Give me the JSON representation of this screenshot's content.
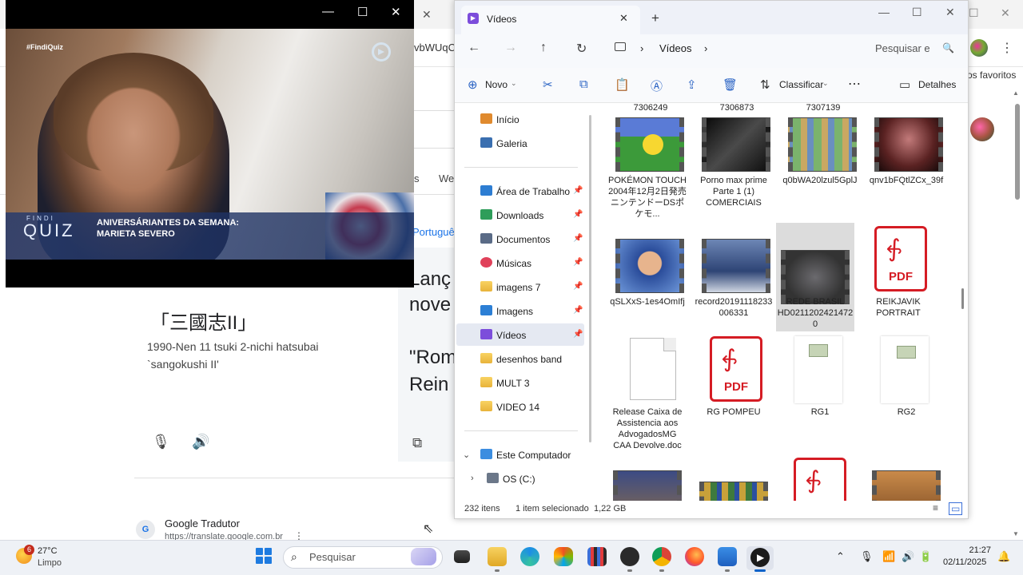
{
  "background_browser": {
    "url_fragment": "vbWUqC",
    "favorites_fragment": "os favoritos",
    "tab_fragments": [
      "s",
      "We"
    ],
    "language_fragment": "Portuguê",
    "kanji": "「三國志II」",
    "romaji_line1": "1990-Nen 11 tsuki 2-nichi hatsubai",
    "romaji_line2": "`sangokushi II'",
    "right_text": [
      "Lanç",
      "nove",
      "\"Rom",
      "Rein"
    ],
    "result_title": "Google Tradutor",
    "result_url": "https://translate.google.com.br",
    "result_icon_text": "G"
  },
  "player": {
    "tag": "#FindiQuiz",
    "findi": "FINDI",
    "quiz": "QUIZ",
    "lower_third_line1": "ANIVERSÁRIANTES DA SEMANA:",
    "lower_third_line2": "MARIETA SEVERO",
    "colors": {
      "lower_third": "#283c6e"
    }
  },
  "explorer": {
    "tab_title": "Vídeos",
    "breadcrumb": [
      "Vídeos"
    ],
    "search_placeholder": "Pesquisar e",
    "toolbar": {
      "new_label": "Novo",
      "sort_label": "Classificar",
      "details_label": "Detalhes"
    },
    "sidebar": [
      {
        "label": "Início",
        "icon": "home-icon",
        "pinned": false
      },
      {
        "label": "Galeria",
        "icon": "gallery-icon",
        "pinned": false
      },
      {
        "label": "Área de Trabalho",
        "icon": "desktop-icon",
        "pinned": true
      },
      {
        "label": "Downloads",
        "icon": "download-icon",
        "pinned": true
      },
      {
        "label": "Documentos",
        "icon": "documents-icon",
        "pinned": true
      },
      {
        "label": "Músicas",
        "icon": "music-icon",
        "pinned": true
      },
      {
        "label": "imagens 7",
        "icon": "folder-icon",
        "pinned": true
      },
      {
        "label": "Imagens",
        "icon": "pictures-icon",
        "pinned": true
      },
      {
        "label": "Vídeos",
        "icon": "videos-icon",
        "pinned": true,
        "selected": true
      },
      {
        "label": "desenhos band",
        "icon": "folder-icon",
        "pinned": false
      },
      {
        "label": "MULT 3",
        "icon": "folder-icon",
        "pinned": false
      },
      {
        "label": "VIDEO 14",
        "icon": "folder-icon",
        "pinned": false
      },
      {
        "label": "Este Computador",
        "icon": "computer-icon",
        "pinned": false
      },
      {
        "label": "OS (C:)",
        "icon": "drive-icon",
        "pinned": false
      }
    ],
    "top_cut_labels": [
      "7306249",
      "7306873",
      "7307139"
    ],
    "files": [
      {
        "name": "POKÉMON TOUCH 2004年12月2日発売 ニンテンドーDSポケモ...",
        "type": "video"
      },
      {
        "name": "Porno max prime Parte 1 (1) COMERCIAIS",
        "type": "video"
      },
      {
        "name": "q0bWA20lzul5GplJ",
        "type": "video"
      },
      {
        "name": "qnv1bFQtlZCx_39f",
        "type": "video"
      },
      {
        "name": "qSLXxS-1es4OmIfj",
        "type": "video"
      },
      {
        "name": "record20191118233006331",
        "type": "video"
      },
      {
        "name": "REDE BRASIL HD02112024214720",
        "type": "video",
        "selected": true
      },
      {
        "name": "REIKJAVIK PORTRAIT",
        "type": "pdf"
      },
      {
        "name": "Release Caixa de Assistencia aos AdvogadosMG CAA Devolve.doc",
        "type": "doc"
      },
      {
        "name": "RG POMPEU",
        "type": "pdf"
      },
      {
        "name": "RG1",
        "type": "image"
      },
      {
        "name": "RG2",
        "type": "image"
      }
    ],
    "pdf_label": "PDF",
    "status_count": "232 itens",
    "status_selection": "1 item selecionado",
    "status_size": "1,22 GB"
  },
  "taskbar": {
    "weather_badge": "6",
    "temperature": "27°C",
    "condition": "Limpo",
    "search_placeholder": "Pesquisar",
    "time": "21:27",
    "date": "02/11/2025"
  }
}
